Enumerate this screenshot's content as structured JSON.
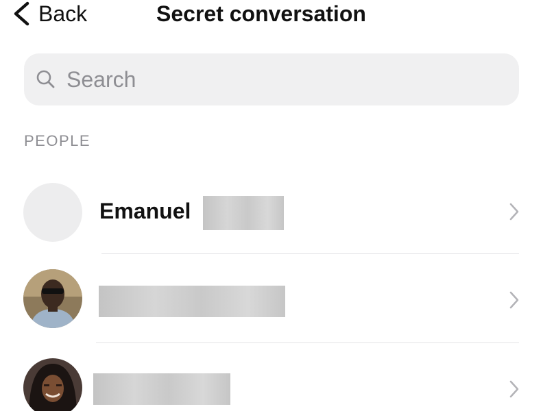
{
  "header": {
    "back_label": "Back",
    "title": "Secret conversation"
  },
  "search": {
    "placeholder": "Search"
  },
  "section": {
    "label": "PEOPLE"
  },
  "people": [
    {
      "name": "Emanuel"
    }
  ],
  "icons": {
    "back": "chevron-left-icon",
    "search": "search-icon",
    "row_arrow": "chevron-right-icon"
  },
  "colors": {
    "search_background": "#f0f0f1",
    "secondary_text": "#8e8e93",
    "divider": "#e2e2e4"
  }
}
